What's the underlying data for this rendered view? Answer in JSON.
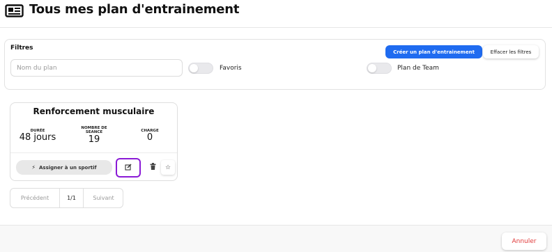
{
  "header": {
    "icon": "newspaper-icon",
    "title": "Tous mes plan d'entrainement"
  },
  "filters": {
    "title": "Filtres",
    "name_placeholder": "Nom du plan",
    "name_value": "",
    "favoris_label": "Favoris",
    "team_label": "Plan de Team",
    "favoris_on": false,
    "team_on": false,
    "create_label": "Créer un plan d'entrainement",
    "clear_label": "Effacer les filtres",
    "accent_color": "#1f6bf0"
  },
  "card": {
    "title": "Renforcement musculaire",
    "stats": [
      {
        "label": "DURÉE",
        "value": "48 jours"
      },
      {
        "label": "NOMBRE DE SEANCE",
        "value": "19"
      },
      {
        "label": "CHARGE",
        "value": "0"
      }
    ],
    "assign_label": "Assigner à un sportif",
    "assign_icon": "bolt-icon",
    "edit_icon": "edit-icon",
    "delete_icon": "trash-icon",
    "favorite_icon": "star-icon",
    "highlight_color": "#8a1ad6"
  },
  "pagination": {
    "prev_label": "Précédent",
    "page_label": "1/1",
    "next_label": "Suivant"
  },
  "footer": {
    "cancel_label": "Annuler",
    "cancel_color": "#e03a3a"
  }
}
